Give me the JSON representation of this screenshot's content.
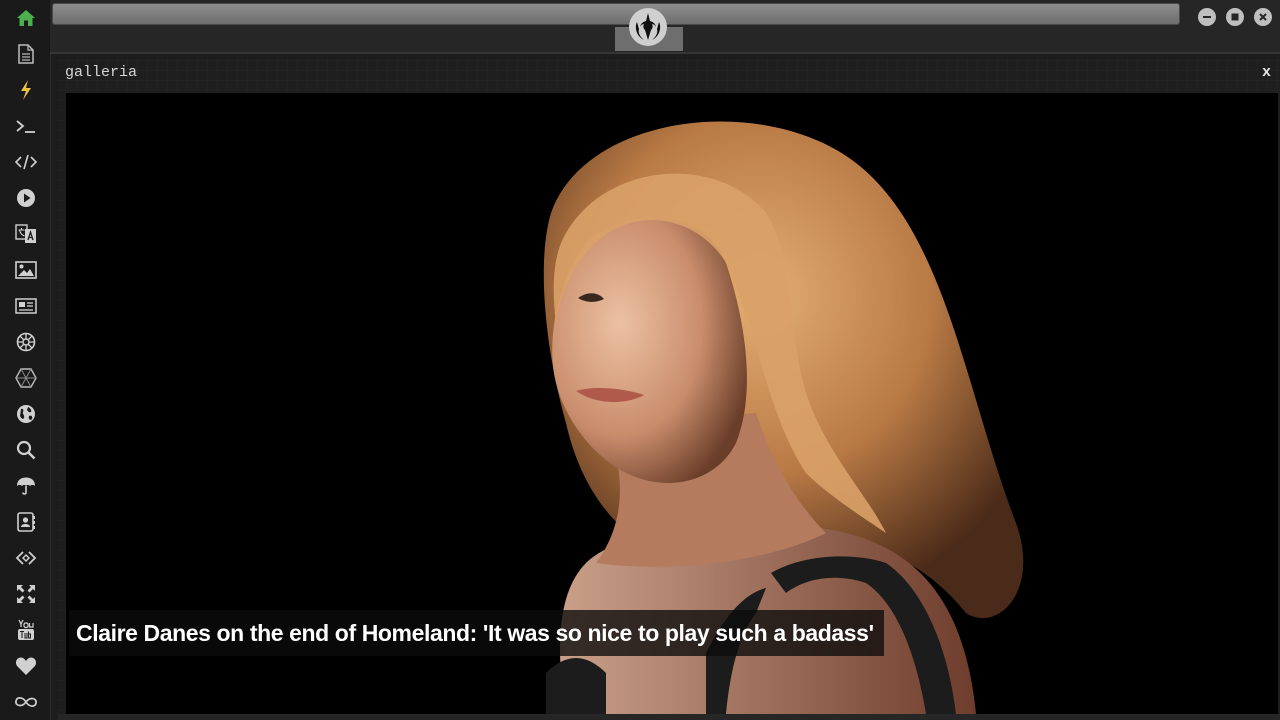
{
  "sidebar": {
    "items": [
      {
        "name": "home-icon",
        "color": "#4caf50"
      },
      {
        "name": "document-icon"
      },
      {
        "name": "lightning-icon",
        "color": "#f0c040"
      },
      {
        "name": "terminal-icon"
      },
      {
        "name": "code-icon"
      },
      {
        "name": "play-icon"
      },
      {
        "name": "translate-icon"
      },
      {
        "name": "image-icon"
      },
      {
        "name": "newspaper-icon"
      },
      {
        "name": "empire-icon"
      },
      {
        "name": "hexagon-icon"
      },
      {
        "name": "globe-icon"
      },
      {
        "name": "search-icon"
      },
      {
        "name": "umbrella-icon"
      },
      {
        "name": "contacts-icon"
      },
      {
        "name": "diamond-code-icon"
      },
      {
        "name": "fullscreen-icon"
      },
      {
        "name": "youtube-icon"
      },
      {
        "name": "heart-icon"
      },
      {
        "name": "infinity-icon"
      }
    ]
  },
  "topbar": {
    "logo_icon": "rebel-alliance-icon",
    "controls": [
      "minimize-icon",
      "maximize-icon",
      "close-icon"
    ]
  },
  "panel": {
    "title": "galleria",
    "close_label": "x"
  },
  "gallery": {
    "caption": "Claire Danes on the end of Homeland: 'It was so nice to play such a badass'"
  }
}
